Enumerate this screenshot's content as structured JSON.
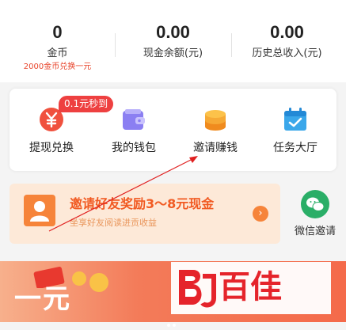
{
  "stats": [
    {
      "value": "0",
      "label": "金币",
      "sub": "2000金币兑换一元"
    },
    {
      "value": "0.00",
      "label": "现金余额(元)"
    },
    {
      "value": "0.00",
      "label": "历史总收入(元)"
    }
  ],
  "grid": {
    "badge": "0.1元秒到",
    "items": [
      {
        "label": "提现兑换",
        "icon": "yuan-coin-icon"
      },
      {
        "label": "我的钱包",
        "icon": "wallet-icon"
      },
      {
        "label": "邀请赚钱",
        "icon": "coin-stack-icon"
      },
      {
        "label": "任务大厅",
        "icon": "calendar-check-icon"
      }
    ]
  },
  "invite": {
    "title": "邀请好友奖励3～8元现金",
    "subtitle": "坐享好友阅读进贡收益"
  },
  "wechat": {
    "label": "微信邀请"
  },
  "promo": {
    "text": "一元"
  },
  "watermark": {
    "text": "百佳",
    "logo": "BJ"
  },
  "colors": {
    "accent": "#e8432a",
    "orange": "#f15a22",
    "wechat_green": "#2aae67"
  }
}
